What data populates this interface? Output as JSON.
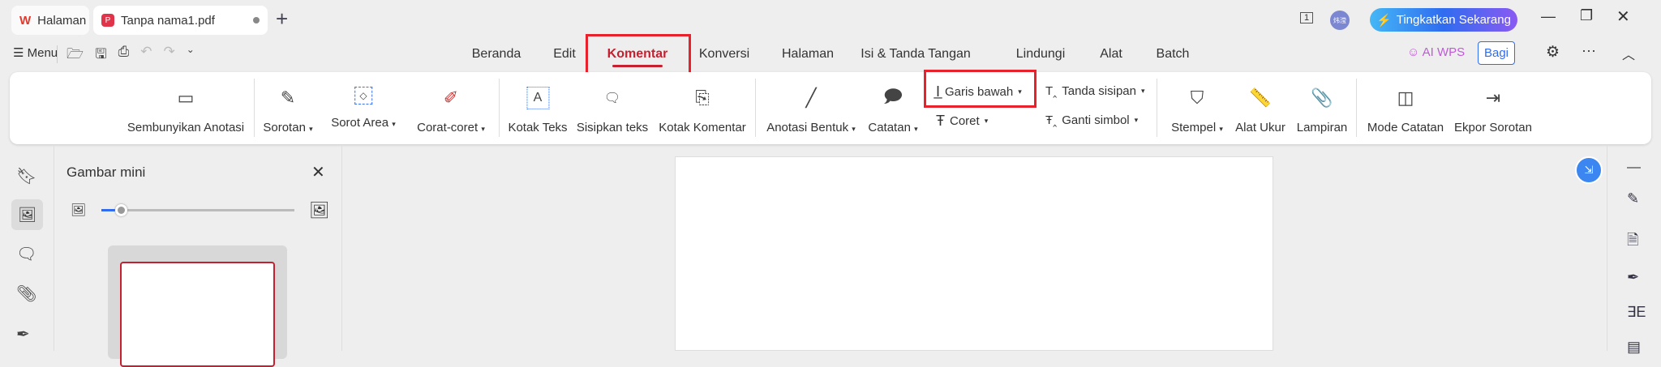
{
  "tabs": [
    {
      "label": "Halaman Muka",
      "icon": "wps-logo-icon"
    },
    {
      "label": "Tanpa nama1.pdf",
      "icon": "pdf-icon"
    }
  ],
  "titlebar": {
    "page_badge": "1",
    "avatar": "炜滢",
    "upgrade_label": "Tingkatkan Sekarang"
  },
  "toolbar": {
    "menu_label": "Menu",
    "ai_label": "AI WPS",
    "share_label": "Bagi"
  },
  "nav": [
    "Beranda",
    "Edit",
    "Komentar",
    "Konversi",
    "Halaman",
    "Isi & Tanda Tangan",
    "Lindungi",
    "Alat",
    "Batch"
  ],
  "ribbon": {
    "hide": "Sembunyikan Anotasi",
    "highlight": "Sorotan",
    "area": "Sorot Area",
    "scribble": "Corat-coret",
    "textbox": "Kotak Teks",
    "insert_text": "Sisipkan teks",
    "comment_box": "Kotak Komentar",
    "shape": "Anotasi Bentuk",
    "note": "Catatan",
    "underline": "Garis bawah",
    "strike": "Coret",
    "caret": "Tanda sisipan",
    "replace": "Ganti simbol",
    "stamp": "Stempel",
    "measure": "Alat Ukur",
    "attach": "Lampiran",
    "note_mode": "Mode Catatan",
    "export": "Ekpor Sorotan"
  },
  "panel": {
    "title": "Gambar mini",
    "thumb_size_percent": 10
  },
  "colors": {
    "accent": "#c62030",
    "highlight_box": "#e8222c",
    "blue": "#3b82f6"
  }
}
